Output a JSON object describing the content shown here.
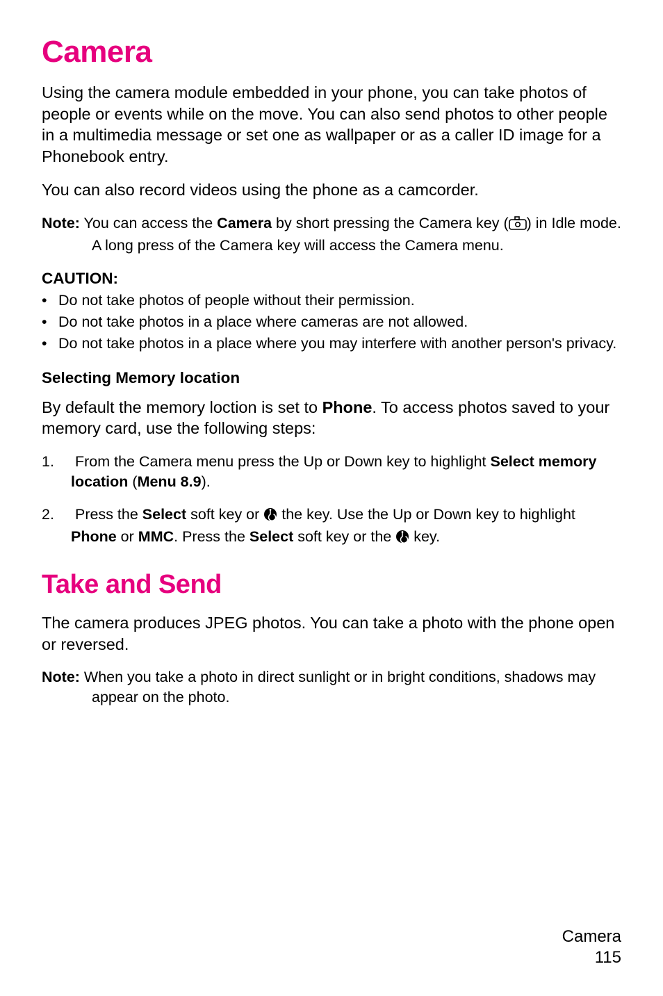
{
  "section_title": "Camera",
  "intro_p1": "Using the camera module embedded in your phone, you can take photos of people or events while on the move. You can also send photos to other people in a multimedia message or set one as wallpaper or as a caller ID image for a Phonebook entry.",
  "intro_p2": "You can also record videos using the phone as a camcorder.",
  "note1_label": "Note:",
  "note1_a": " You can access the ",
  "note1_b_word": "Camera",
  "note1_c": " by short pressing the Camera key (",
  "note1_d": ") in Idle mode. A long press of the Camera key will access the Camera menu.",
  "caution_label": "CAUTION:",
  "cautions": [
    "Do not take photos of people without their permission.",
    "Do not take photos in a place where cameras are not allowed.",
    "Do not take photos in a place where you may interfere with another person's privacy."
  ],
  "subheading": "Selecting Memory location",
  "memloc_p_a": "By default the memory loction is set to ",
  "memloc_p_b_word": "Phone",
  "memloc_p_c": ". To access photos saved to your memory card, use the following steps:",
  "step1_a": "From the Camera menu press the Up or Down key to highlight ",
  "step1_b_word": "Select memory location",
  "step1_c": " (",
  "step1_d_word": "Menu 8.9",
  "step1_e": ").",
  "step2_a": "Press the ",
  "step2_b_word": "Select",
  "step2_c": " soft key or  ",
  "step2_d": " the  key. Use the Up or Down key to highlight ",
  "step2_e_word": "Phone",
  "step2_f": " or ",
  "step2_g_word": "MMC",
  "step2_h": ". Press the ",
  "step2_i_word": "Select",
  "step2_j": " soft key or the  ",
  "step2_k": " key.",
  "section2_title": "Take and Send",
  "take_p1": "The camera produces JPEG photos. You can take a photo with the phone open or reversed.",
  "note2_label": "Note:",
  "note2_text": " When you take a photo in direct sunlight or in bright conditions, shadows may appear on the photo.",
  "footer_section": "Camera",
  "footer_page": "115"
}
